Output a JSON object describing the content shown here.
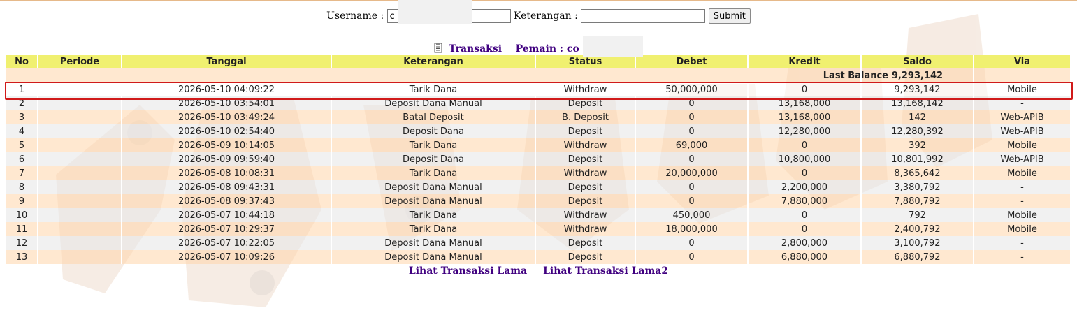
{
  "filter": {
    "username_label": "Username :",
    "username_value": "c",
    "keterangan_label": "Keterangan :",
    "keterangan_value": "",
    "submit_label": "Submit"
  },
  "title": {
    "transaksi": "Transaksi",
    "pemain_label": "Pemain : co"
  },
  "table": {
    "headers": [
      "No",
      "Periode",
      "Tanggal",
      "Keterangan",
      "Status",
      "Debet",
      "Kredit",
      "Saldo",
      "Via"
    ],
    "last_balance_label": "Last Balance",
    "last_balance_value": "9,293,142",
    "rows": [
      {
        "no": "1",
        "periode": "",
        "tanggal": "2026-05-10 04:09:22",
        "keterangan": "Tarik Dana",
        "status": "Withdraw",
        "debet": "50,000,000",
        "kredit": "0",
        "saldo": "9,293,142",
        "via": "Mobile"
      },
      {
        "no": "2",
        "periode": "",
        "tanggal": "2026-05-10 03:54:01",
        "keterangan": "Deposit Dana Manual",
        "status": "Deposit",
        "debet": "0",
        "kredit": "13,168,000",
        "saldo": "13,168,142",
        "via": "-"
      },
      {
        "no": "3",
        "periode": "",
        "tanggal": "2026-05-10 03:49:24",
        "keterangan": "Batal Deposit",
        "status": "B. Deposit",
        "debet": "0",
        "kredit": "13,168,000",
        "saldo": "142",
        "via": "Web-APIB"
      },
      {
        "no": "4",
        "periode": "",
        "tanggal": "2026-05-10 02:54:40",
        "keterangan": "Deposit Dana",
        "status": "Deposit",
        "debet": "0",
        "kredit": "12,280,000",
        "saldo": "12,280,392",
        "via": "Web-APIB"
      },
      {
        "no": "5",
        "periode": "",
        "tanggal": "2026-05-09 10:14:05",
        "keterangan": "Tarik Dana",
        "status": "Withdraw",
        "debet": "69,000",
        "kredit": "0",
        "saldo": "392",
        "via": "Mobile"
      },
      {
        "no": "6",
        "periode": "",
        "tanggal": "2026-05-09 09:59:40",
        "keterangan": "Deposit Dana",
        "status": "Deposit",
        "debet": "0",
        "kredit": "10,800,000",
        "saldo": "10,801,992",
        "via": "Web-APIB"
      },
      {
        "no": "7",
        "periode": "",
        "tanggal": "2026-05-08 10:08:31",
        "keterangan": "Tarik Dana",
        "status": "Withdraw",
        "debet": "20,000,000",
        "kredit": "0",
        "saldo": "8,365,642",
        "via": "Mobile"
      },
      {
        "no": "8",
        "periode": "",
        "tanggal": "2026-05-08 09:43:31",
        "keterangan": "Deposit Dana Manual",
        "status": "Deposit",
        "debet": "0",
        "kredit": "2,200,000",
        "saldo": "3,380,792",
        "via": "-"
      },
      {
        "no": "9",
        "periode": "",
        "tanggal": "2026-05-08 09:37:43",
        "keterangan": "Deposit Dana Manual",
        "status": "Deposit",
        "debet": "0",
        "kredit": "7,880,000",
        "saldo": "7,880,792",
        "via": "-"
      },
      {
        "no": "10",
        "periode": "",
        "tanggal": "2026-05-07 10:44:18",
        "keterangan": "Tarik Dana",
        "status": "Withdraw",
        "debet": "450,000",
        "kredit": "0",
        "saldo": "792",
        "via": "Mobile"
      },
      {
        "no": "11",
        "periode": "",
        "tanggal": "2026-05-07 10:29:37",
        "keterangan": "Tarik Dana",
        "status": "Withdraw",
        "debet": "18,000,000",
        "kredit": "0",
        "saldo": "2,400,792",
        "via": "Mobile"
      },
      {
        "no": "12",
        "periode": "",
        "tanggal": "2026-05-07 10:22:05",
        "keterangan": "Deposit Dana Manual",
        "status": "Deposit",
        "debet": "0",
        "kredit": "2,800,000",
        "saldo": "3,100,792",
        "via": "-"
      },
      {
        "no": "13",
        "periode": "",
        "tanggal": "2026-05-07 10:09:26",
        "keterangan": "Deposit Dana Manual",
        "status": "Deposit",
        "debet": "0",
        "kredit": "6,880,000",
        "saldo": "6,880,792",
        "via": "-"
      }
    ]
  },
  "links": {
    "lama": "Lihat Transaksi Lama",
    "lama2": "Lihat Transaksi Lama2"
  },
  "colors": {
    "header_bg": "#f0f070",
    "row_peach": "#ffd6aa",
    "row_gray": "#e8e8e8",
    "status_red": "#cc2222",
    "value_purple": "#6a22cc",
    "link_purple": "#400080",
    "highlight_red": "#d01a1a"
  },
  "icons": {
    "title_icon": "document-icon"
  }
}
